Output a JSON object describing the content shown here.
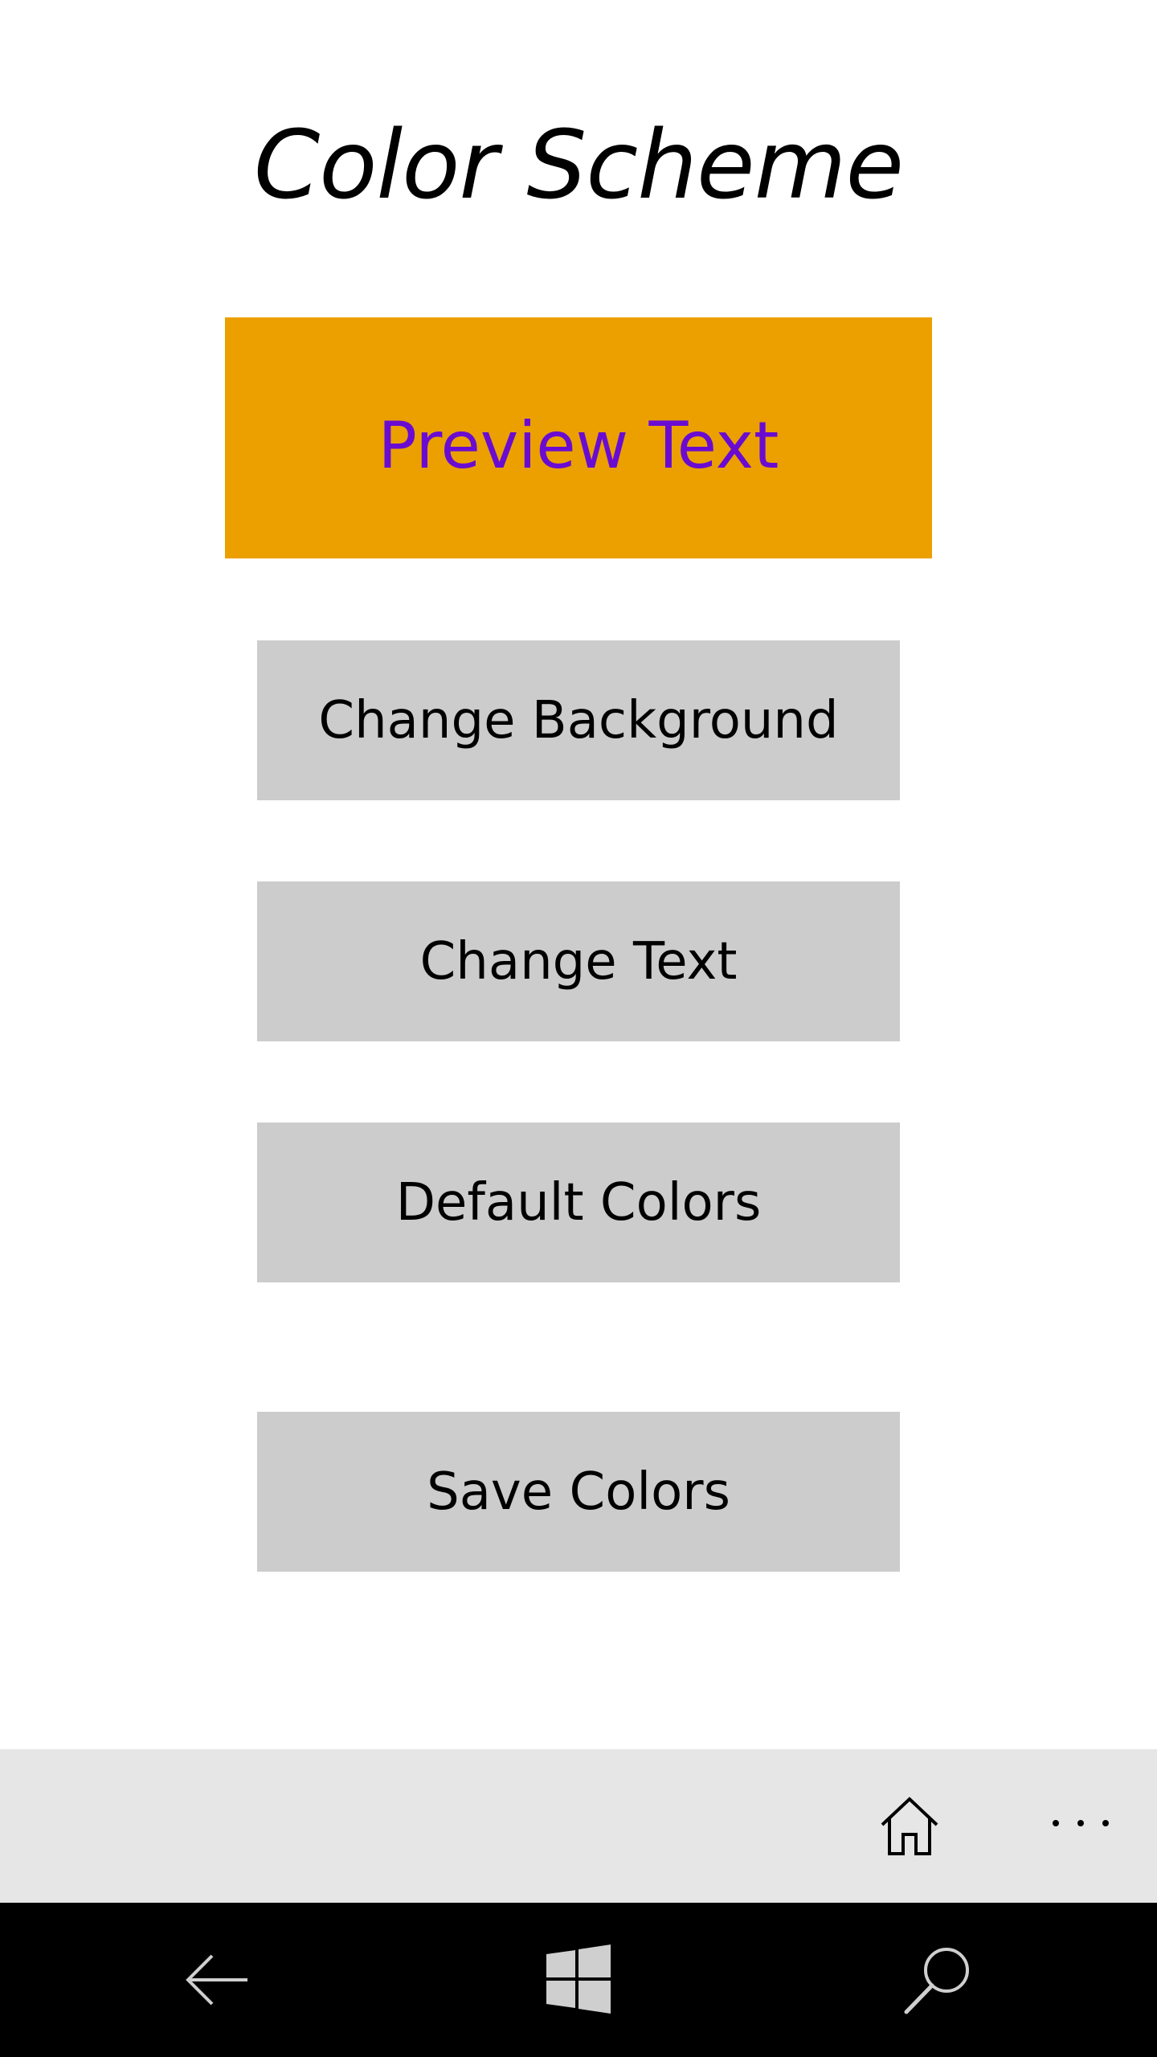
{
  "page": {
    "title": "Color Scheme"
  },
  "preview": {
    "text": "Preview Text",
    "background_color": "#eba000",
    "text_color": "#6a0bd2"
  },
  "buttons": {
    "change_background": "Change Background",
    "change_text": "Change Text",
    "default_colors": "Default Colors",
    "save_colors": "Save Colors"
  },
  "app_bar": {
    "primary_icon": "home-icon",
    "overflow_icon": "more-icon"
  },
  "nav_bar": {
    "back_icon": "back-arrow-icon",
    "start_icon": "windows-logo-icon",
    "search_icon": "search-icon"
  }
}
